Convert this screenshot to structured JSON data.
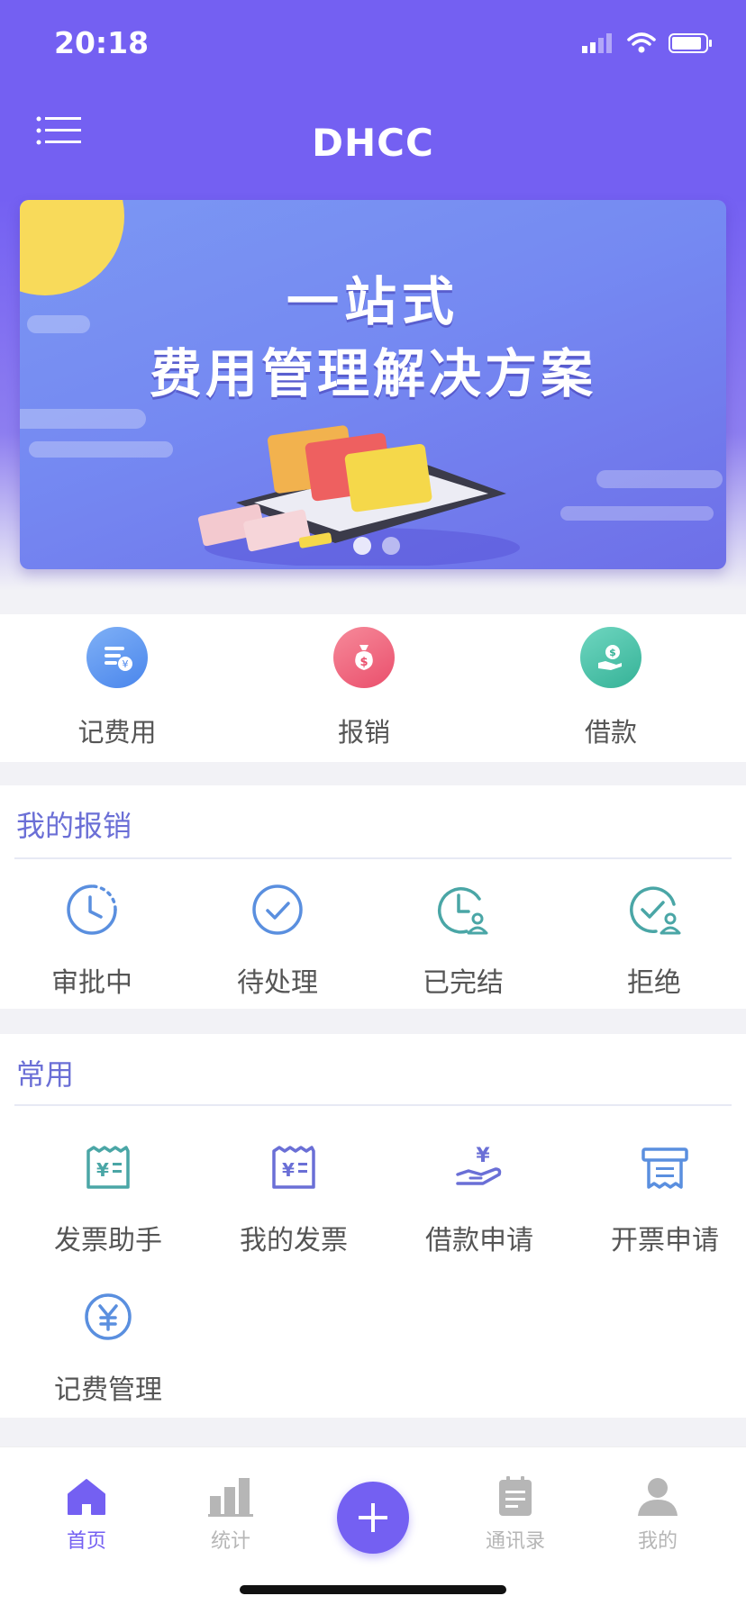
{
  "status_bar": {
    "time": "20:18"
  },
  "header": {
    "title": "DHCC"
  },
  "banner": {
    "line1": "一站式",
    "line2": "费用管理解决方案"
  },
  "quick_actions": [
    {
      "label": "记费用",
      "icon": "expense-record-icon",
      "color": "#5b8ff2"
    },
    {
      "label": "报销",
      "icon": "money-bag-icon",
      "color": "#f0607a"
    },
    {
      "label": "借款",
      "icon": "hand-coin-icon",
      "color": "#3fbfa6"
    }
  ],
  "my_reimbursement": {
    "title": "我的报销",
    "items": [
      {
        "label": "审批中",
        "icon": "clock-pending-icon"
      },
      {
        "label": "待处理",
        "icon": "check-circle-icon"
      },
      {
        "label": "已完结",
        "icon": "clock-user-icon"
      },
      {
        "label": "拒绝",
        "icon": "check-user-icon"
      }
    ]
  },
  "common": {
    "title": "常用",
    "items": [
      {
        "label": "发票助手",
        "icon": "invoice-helper-icon"
      },
      {
        "label": "我的发票",
        "icon": "my-invoice-icon"
      },
      {
        "label": "借款申请",
        "icon": "loan-apply-icon"
      },
      {
        "label": "开票申请",
        "icon": "printer-invoice-icon"
      },
      {
        "label": "记费管理",
        "icon": "yen-circle-icon"
      }
    ]
  },
  "tabbar": {
    "tabs": [
      {
        "label": "首页",
        "icon": "home-icon",
        "active": true
      },
      {
        "label": "统计",
        "icon": "bar-chart-icon",
        "active": false
      },
      {
        "label": "通讯录",
        "icon": "contacts-icon",
        "active": false
      },
      {
        "label": "我的",
        "icon": "user-icon",
        "active": false
      }
    ],
    "fab_icon": "plus-icon"
  },
  "colors": {
    "primary": "#7460f2",
    "section_title": "#6b6fd6",
    "icon_blue": "#5a8fdf",
    "icon_teal": "#4aa6a6"
  }
}
